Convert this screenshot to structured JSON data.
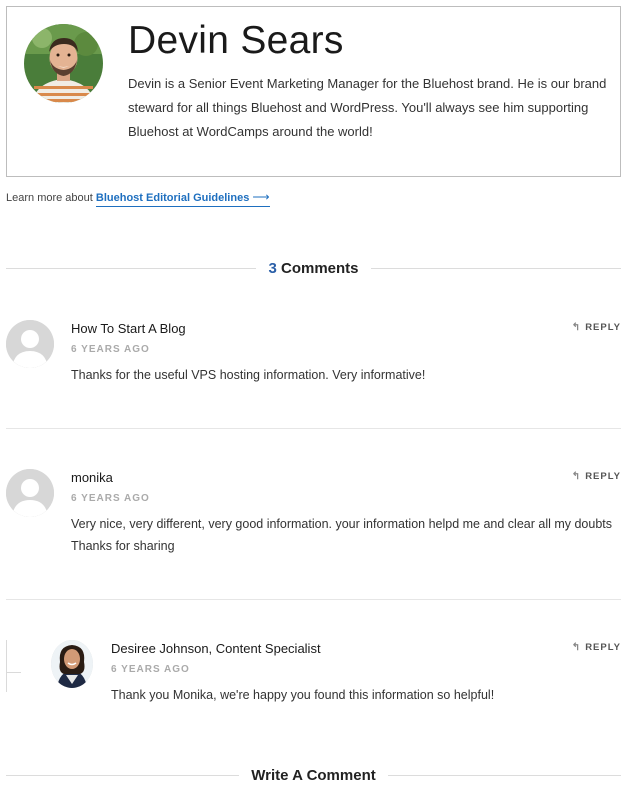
{
  "author": {
    "name": "Devin Sears",
    "bio": "Devin is a Senior Event Marketing Manager for the Bluehost brand. He is our brand steward for all things Bluehost and WordPress. You'll always see him supporting Bluehost at WordCamps around the world!",
    "avatar_icon": "author-photo"
  },
  "guidelines": {
    "prefix": "Learn more about",
    "link": "Bluehost Editorial Guidelines",
    "arrow": "⟶"
  },
  "comments_header": {
    "count": "3",
    "label": "Comments"
  },
  "comments": [
    {
      "name": "How To Start A Blog",
      "date": "6 YEARS AGO",
      "text": "Thanks for the useful VPS hosting information. Very informative!",
      "reply": "REPLY"
    },
    {
      "name": "monika",
      "date": "6 YEARS AGO",
      "text": "Very nice, very different, very good information. your information helpd me and clear all my doubts Thanks for sharing",
      "reply": "REPLY"
    },
    {
      "name": "Desiree Johnson, Content Specialist",
      "date": "6 YEARS AGO",
      "text": "Thank you Monika, we're happy you found this information so helpful!",
      "reply": "REPLY"
    }
  ],
  "write_header": {
    "label": "Write A Comment"
  },
  "colors": {
    "link": "#1e6fbf",
    "count": "#2a5fa8",
    "muted": "#aaaaaa",
    "border": "#bdbdbd"
  }
}
